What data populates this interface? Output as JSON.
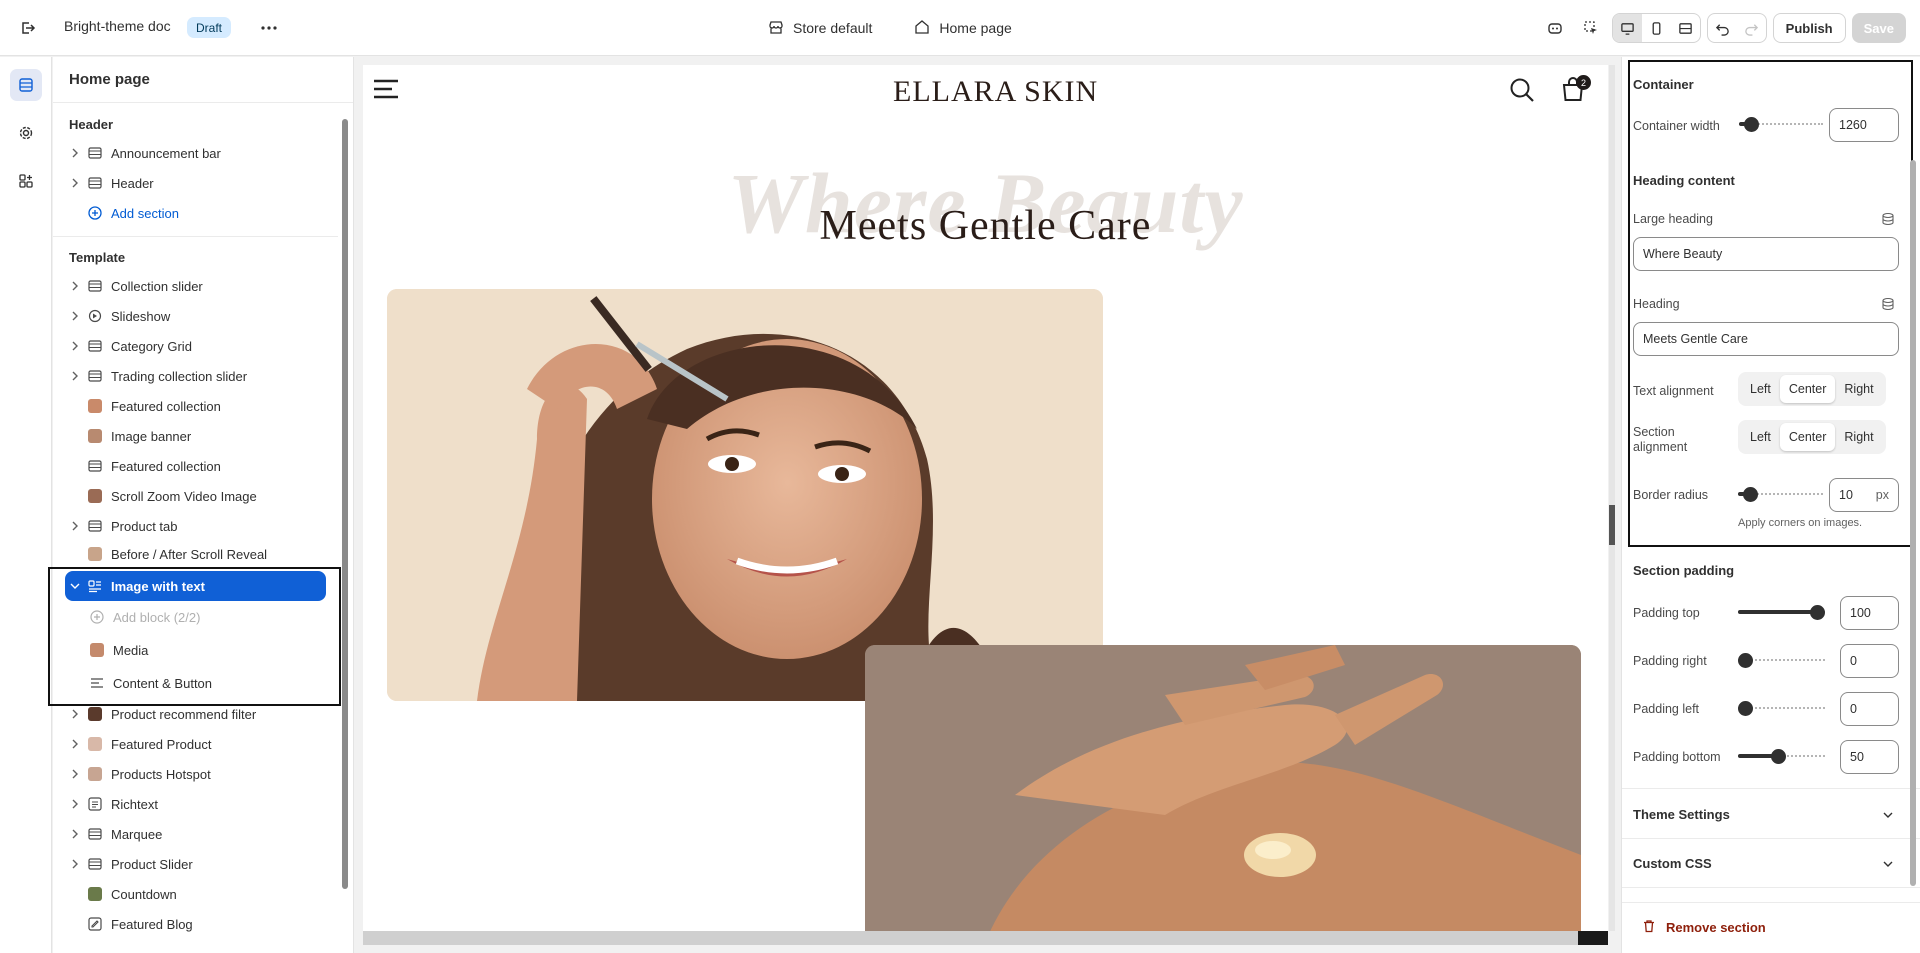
{
  "topbar": {
    "doc_title": "Bright-theme doc",
    "status_badge": "Draft",
    "store_label": "Store default",
    "page_label": "Home page",
    "publish_label": "Publish",
    "save_label": "Save"
  },
  "tree": {
    "title": "Home page",
    "header_group": "Header",
    "header_items": [
      "Announcement bar",
      "Header"
    ],
    "add_section": "Add section",
    "template_group": "Template",
    "template_items": [
      "Collection slider",
      "Slideshow",
      "Category Grid",
      "Trading collection slider",
      "Featured collection",
      "Image banner",
      "Featured collection",
      "Scroll Zoom Video Image",
      "Product tab",
      "Before / After Scroll Reveal"
    ],
    "selected_section": "Image with text",
    "add_block": "Add block (2/2)",
    "blocks": [
      "Media",
      "Content & Button"
    ],
    "more_items": [
      "Product recommend filter",
      "Featured Product",
      "Products Hotspot",
      "Richtext",
      "Marquee",
      "Product Slider",
      "Countdown",
      "Featured Blog"
    ]
  },
  "preview": {
    "logo": "ELLARA SKIN",
    "cart_count": "2",
    "large_heading": "Where Beauty",
    "heading": "Meets Gentle Care"
  },
  "settings": {
    "container_title": "Container",
    "container_width_label": "Container width",
    "container_width_value": "1260",
    "heading_content_title": "Heading content",
    "large_heading_label": "Large heading",
    "large_heading_value": "Where Beauty",
    "heading_label": "Heading",
    "heading_value": "Meets Gentle Care",
    "text_alignment_label": "Text alignment",
    "section_alignment_label": "Section alignment",
    "align_options": [
      "Left",
      "Center",
      "Right"
    ],
    "border_radius_label": "Border radius",
    "border_radius_value": "10",
    "border_radius_unit": "px",
    "border_radius_note": "Apply corners on images.",
    "section_padding_title": "Section padding",
    "padding_top_label": "Padding top",
    "padding_top_value": "100",
    "padding_right_label": "Padding right",
    "padding_right_value": "0",
    "padding_left_label": "Padding left",
    "padding_left_value": "0",
    "padding_bottom_label": "Padding bottom",
    "padding_bottom_value": "50",
    "theme_settings": "Theme Settings",
    "custom_css": "Custom CSS",
    "remove_section": "Remove section"
  },
  "colors": {
    "accent": "#1060d6",
    "danger": "#8e1f0b",
    "badge_bg": "#d5ebff"
  }
}
